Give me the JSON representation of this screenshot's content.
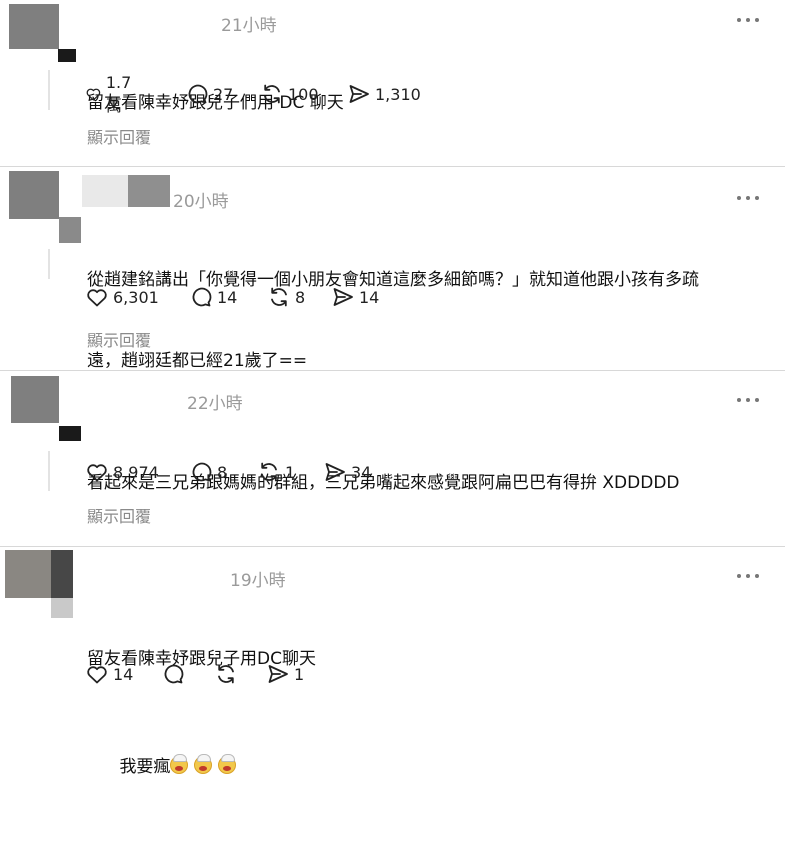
{
  "posts": [
    {
      "time": "21小時",
      "lines": [
        "留友看陳幸妤跟兒子們用 DC 聊天"
      ],
      "likes": "1.7 萬",
      "comments": "27",
      "reposts": "100",
      "shares": "1,310",
      "reply_label": "顯示回覆"
    },
    {
      "time": "20小時",
      "lines": [
        "從趙建銘講出「你覺得一個小朋友會知道這麼多細節嗎？」就知道他跟小孩有多疏",
        "遠，趙翊廷都已經21歲了=="
      ],
      "likes": "6,301",
      "comments": "14",
      "reposts": "8",
      "shares": "14",
      "reply_label": "顯示回覆"
    },
    {
      "time": "22小時",
      "lines": [
        "看起來是三兄弟跟媽媽的群組，三兄弟嘴起來感覺跟阿扁巴巴有得拚 XDDDDD"
      ],
      "likes": "8,974",
      "comments": "8",
      "reposts": "1",
      "shares": "34",
      "reply_label": "顯示回覆"
    },
    {
      "time": "19小時",
      "lines": [
        "留友看陳幸妤跟兒子用DC聊天",
        "我要瘋"
      ],
      "emoji_count": 3,
      "likes": "14",
      "comments": "",
      "reposts": "",
      "shares": "1"
    }
  ],
  "icons": {
    "like": "heart-icon",
    "comment": "comment-bubble-icon",
    "repost": "repost-icon",
    "share": "send-icon",
    "more": "more-dots-icon",
    "emoji": "exploding-head-emoji"
  },
  "colors": {
    "avatar_gray": "#7f7f7f",
    "muted_text": "#9a9a9a",
    "separator": "#d8d8d8"
  }
}
